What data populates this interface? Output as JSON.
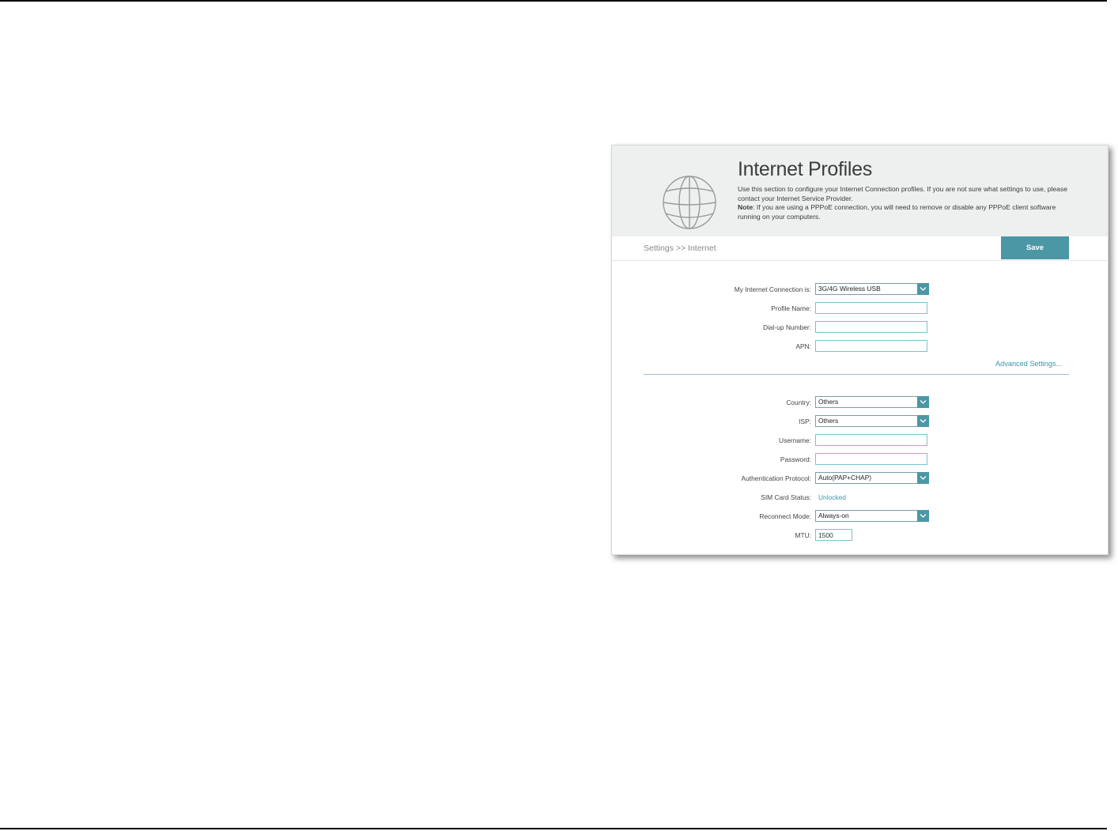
{
  "header": {
    "title": "Internet Profiles",
    "description_line1": "Use this section to configure your Internet Connection profiles. If you are not sure what settings to use, please",
    "description_line2": "contact your Internet Service Provider.",
    "note_label": "Note",
    "note_text": ": If you are using a PPPoE connection, you will need to remove or disable any PPPoE client software",
    "note_line2": "running on your computers.",
    "icon": "globe-icon"
  },
  "subbar": {
    "breadcrumb": "Settings >> Internet",
    "save_label": "Save"
  },
  "form": {
    "connection": {
      "label": "My Internet Connection is:",
      "value": "3G/4G Wireless USB"
    },
    "profile_name": {
      "label": "Profile Name:",
      "value": ""
    },
    "dialup_number": {
      "label": "Dial-up Number:",
      "value": ""
    },
    "apn": {
      "label": "APN:",
      "value": ""
    },
    "advanced_link": "Advanced Settings...",
    "country": {
      "label": "Country:",
      "value": "Others"
    },
    "isp": {
      "label": "ISP:",
      "value": "Others"
    },
    "username": {
      "label": "Username:",
      "value": ""
    },
    "password": {
      "label": "Password:",
      "value": ""
    },
    "auth_protocol": {
      "label": "Authentication Protocol:",
      "value": "Auto(PAP+CHAP)"
    },
    "sim_status": {
      "label": "SIM Card Status:",
      "value": "Unlocked"
    },
    "reconnect_mode": {
      "label": "Reconnect Mode:",
      "value": "Always-on"
    },
    "mtu": {
      "label": "MTU:",
      "value": "1500"
    }
  },
  "colors": {
    "accent": "#4c97a6",
    "link": "#3a96a8",
    "header_bg": "#eef0f0"
  }
}
